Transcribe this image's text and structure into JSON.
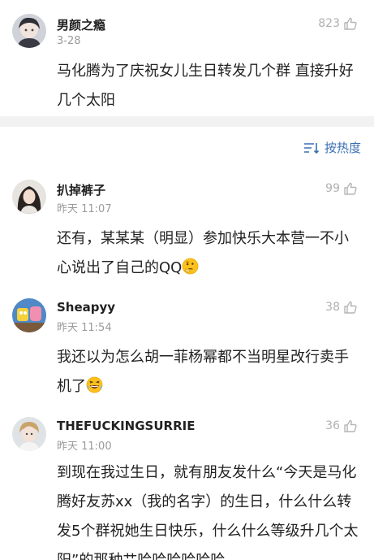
{
  "top_comment": {
    "user": "男颜之瘾",
    "time": "3-28",
    "likes": "823",
    "text": "马化腾为了庆祝女儿生日转发几个群 直接升好几个太阳"
  },
  "sort": {
    "label": "按热度"
  },
  "comments": [
    {
      "user": "扒掉裤子",
      "time": "昨天 11:07",
      "likes": "99",
      "text": "还有，某某某（明显）参加快乐大本营一不小心说出了自己的QQ"
    },
    {
      "user": "Sheapyy",
      "time": "昨天 11:54",
      "likes": "38",
      "text": "我还以为怎么胡一菲杨幂都不当明星改行卖手机了"
    },
    {
      "user": "THEFUCKINGSURRIE",
      "time": "昨天 11:00",
      "likes": "36",
      "text": "到现在我过生日，就有朋友发什么“今天是马化腾好友苏xx（我的名字）的生日，什么什么转发5个群祝她生日快乐，什么什么等级升几个太阳”的那种艹哈哈哈哈哈哈"
    }
  ],
  "colors": {
    "accent": "#3b6fb4",
    "meta": "#9a9a9a",
    "divider": "#f2f2f2"
  }
}
